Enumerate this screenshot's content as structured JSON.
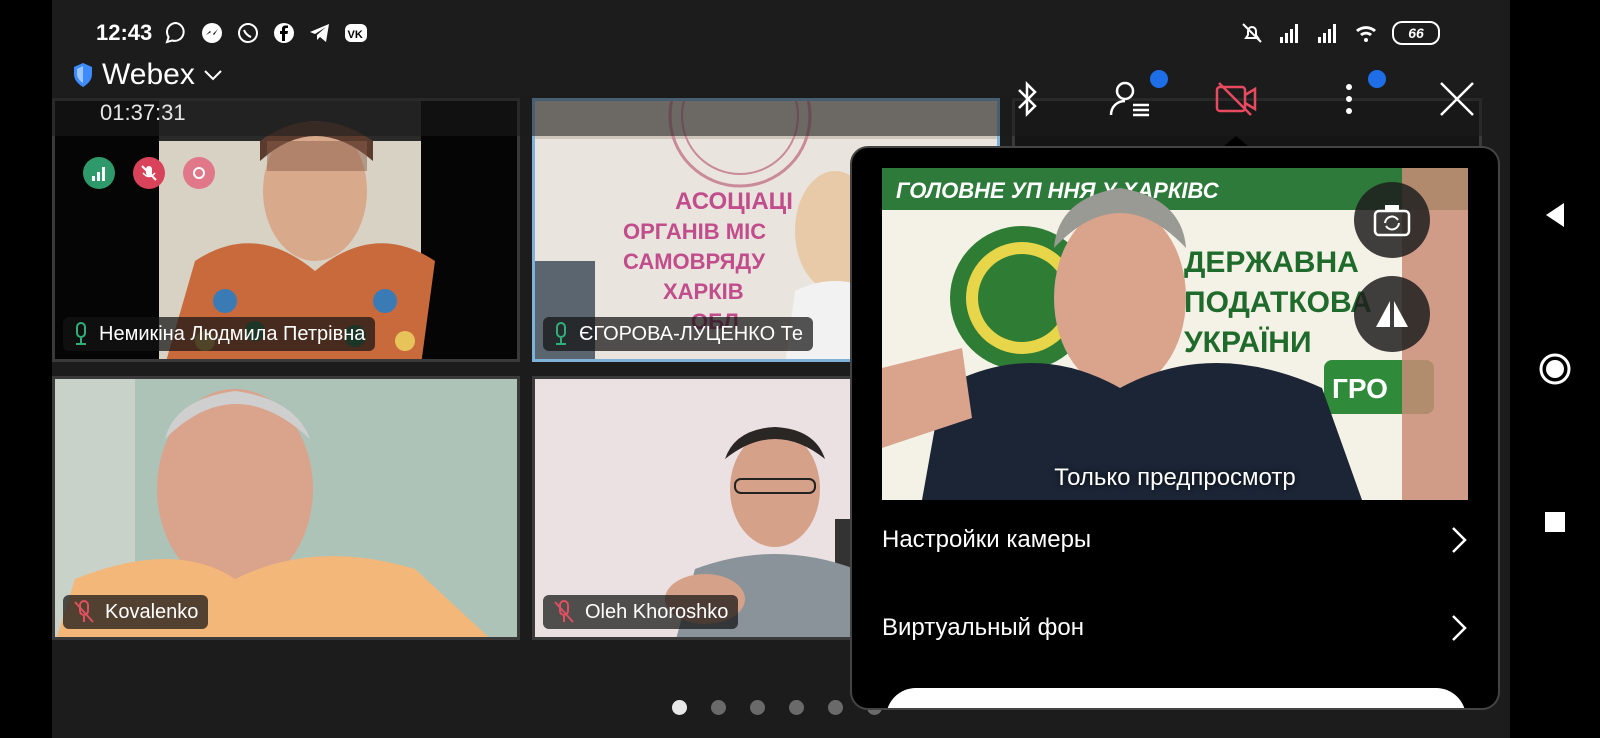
{
  "status_bar": {
    "time": "12:43",
    "left_icons": [
      "viber-icon",
      "messenger-icon",
      "whatsapp-icon",
      "facebook-icon",
      "telegram-icon",
      "vk-icon"
    ],
    "right_icons": [
      "mute-bell-icon",
      "signal-icon",
      "signal-icon",
      "wifi-icon"
    ],
    "battery": "66"
  },
  "header": {
    "app_name": "Webex",
    "timer": "01:37:31"
  },
  "toolbar": {
    "icons": [
      "bluetooth-icon",
      "participants-icon",
      "camera-off-icon",
      "more-icon",
      "close-icon"
    ],
    "camera_off_color": "#e84a5f",
    "badge_color": "#1e6ee8"
  },
  "tiles": [
    {
      "name": "Немикіна Людмила Петрівна",
      "mic": "on"
    },
    {
      "name": "ЄГОРОВА-ЛУЦЕНКО Те",
      "mic": "on",
      "sign": [
        "АСОЦІАЦІ",
        "ОРГАНІВ МІС",
        "САМОВРЯДУ",
        "ХАРКІВ",
        "ОБЛ"
      ]
    },
    {
      "name": "Kovalenko",
      "mic": "muted"
    },
    {
      "name": "Oleh Khoroshko",
      "mic": "muted"
    }
  ],
  "indicators": [
    "network-icon",
    "muted-mic-icon",
    "recording-icon"
  ],
  "camera_sheet": {
    "banner": "ГОЛОВНЕ УП        ННЯ У ХАРКІВС",
    "sign_lines": [
      "ДЕРЖАВНА",
      "ПОДАТКОВА",
      "УКРАЇНИ"
    ],
    "sign_badge": "ГРО",
    "preview_label": "Только предпросмотр",
    "menu": [
      {
        "label": "Настройки камеры"
      },
      {
        "label": "Виртуальный фон"
      }
    ]
  },
  "pager": {
    "count": 6,
    "active": 0
  },
  "android_nav": [
    "back-icon",
    "home-icon",
    "recents-icon"
  ]
}
